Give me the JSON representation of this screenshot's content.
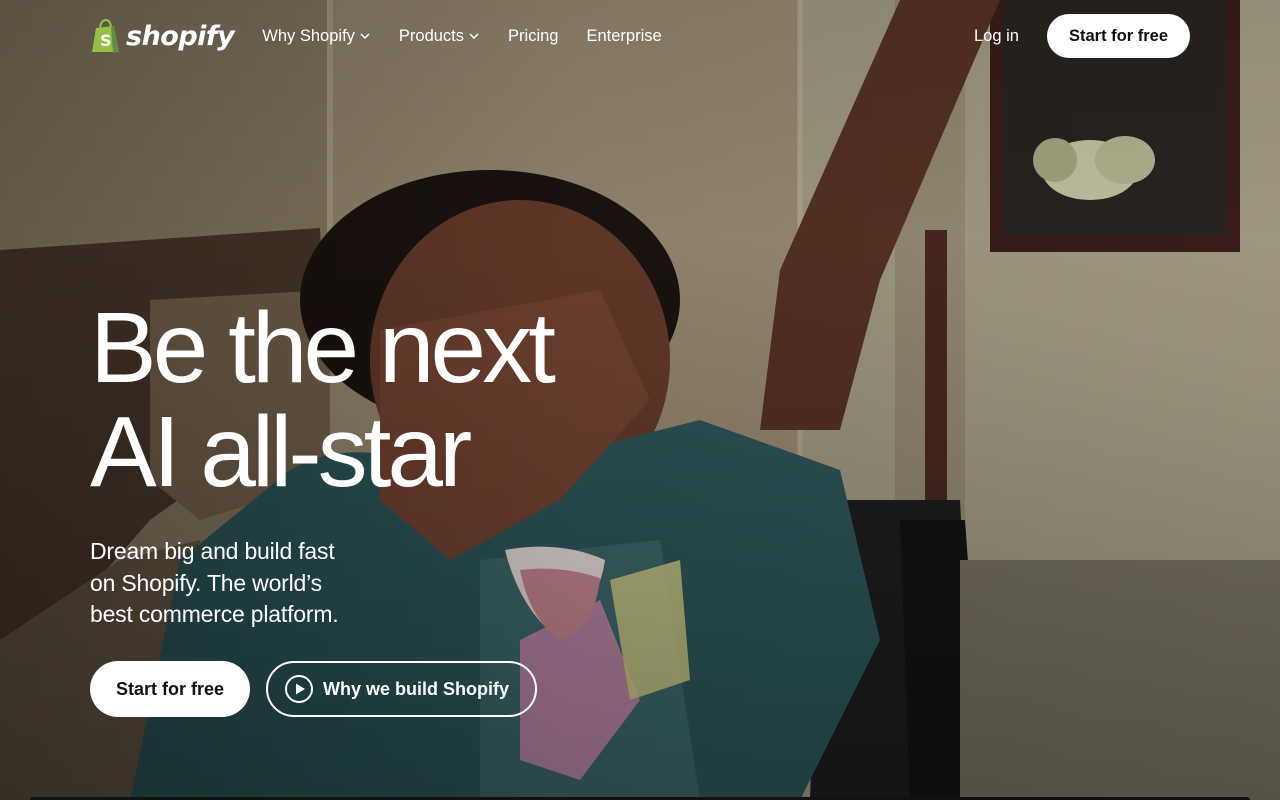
{
  "brand": {
    "name": "shopify",
    "logo_icon": "shopify-bag-icon",
    "logo_color": "#95bf47"
  },
  "nav": {
    "items": [
      {
        "label": "Why Shopify",
        "has_dropdown": true
      },
      {
        "label": "Products",
        "has_dropdown": true
      },
      {
        "label": "Pricing",
        "has_dropdown": false
      },
      {
        "label": "Enterprise",
        "has_dropdown": false
      }
    ],
    "login_label": "Log in",
    "cta_label": "Start for free"
  },
  "hero": {
    "headline_line1": "Be the next",
    "headline_line2": "AI all-star",
    "subhead_line1": "Dream big and build fast",
    "subhead_line2": "on Shopify. The world’s",
    "subhead_line3": "best commerce platform.",
    "primary_cta": "Start for free",
    "secondary_cta": "Why we build Shopify",
    "secondary_icon": "play-circle-icon"
  },
  "colors": {
    "button_bg": "#ffffff",
    "button_text": "#111111",
    "text": "#ffffff"
  }
}
